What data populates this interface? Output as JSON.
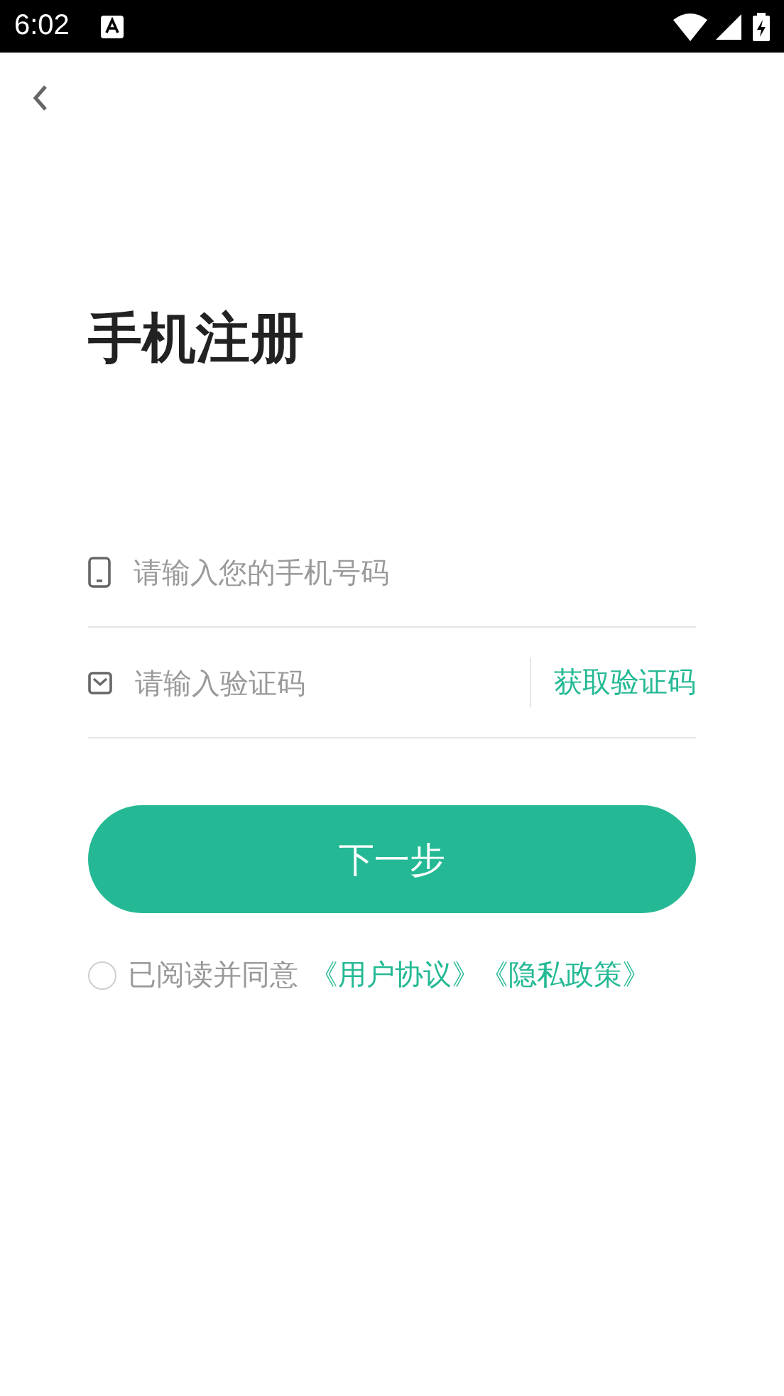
{
  "status_bar": {
    "time": "6:02"
  },
  "title": "手机注册",
  "phone_field": {
    "placeholder": "请输入您的手机号码"
  },
  "code_field": {
    "placeholder": "请输入验证码",
    "action": "获取验证码"
  },
  "submit_button": "下一步",
  "agreement": {
    "checked": false,
    "text": "已阅读并同意",
    "links": [
      "《用户协议》",
      "《隐私政策》"
    ]
  }
}
